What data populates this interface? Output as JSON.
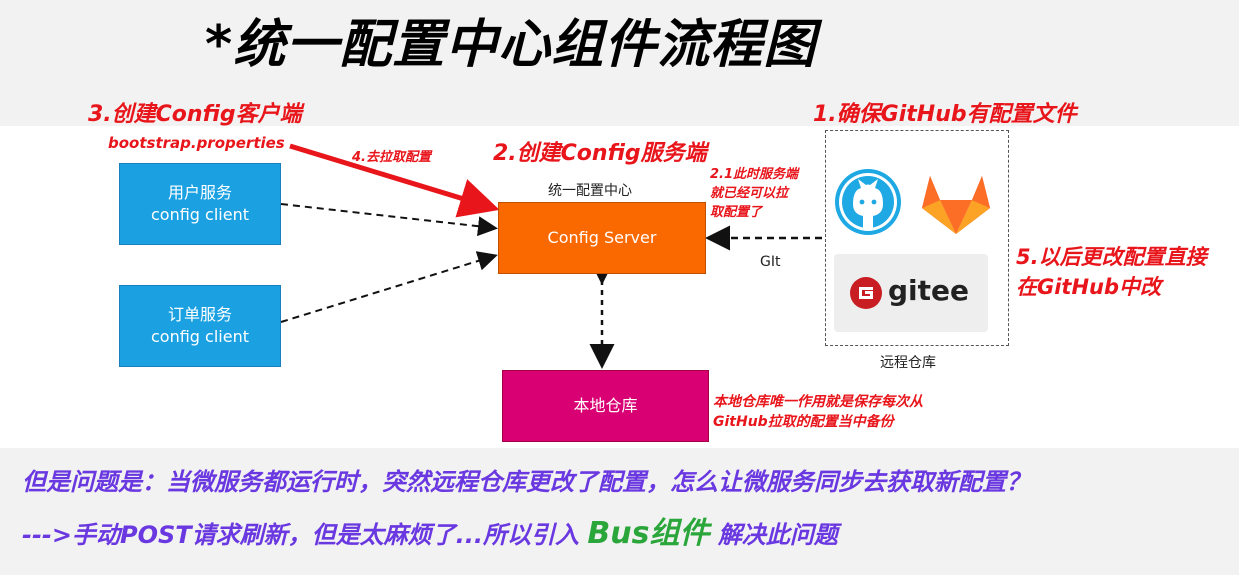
{
  "title": "*统一配置中心组件流程图",
  "steps": {
    "step1": "1.确保GitHub有配置文件",
    "step2": "2.创建Config服务端",
    "step2_1_line1": "2.1此时服务端",
    "step2_1_line2": "就已经可以拉",
    "step2_1_line3": "取配置了",
    "step3": "3.创建Config客户端",
    "step3_file": "bootstrap.properties",
    "step4": "4.去拉取配置",
    "step5_line1": "5.以后更改配置直接",
    "step5_line2": "在GitHub中改"
  },
  "nodes": {
    "user_service_line1": "用户服务",
    "user_service_line2": "config client",
    "order_service_line1": "订单服务",
    "order_service_line2": "config client",
    "server_caption": "统一配置中心",
    "server_label": "Config Server",
    "local_repo": "本地仓库",
    "remote_repo": "远程仓库",
    "git_label": "GIt",
    "gitee_text": "gitee"
  },
  "notes": {
    "local_note_line1": "本地仓库唯一作用就是保存每次从",
    "local_note_line2": "GitHub拉取的配置当中备份"
  },
  "bottom": {
    "question": "但是问题是：当微服务都运行时，突然远程仓库更改了配置，怎么让微服务同步去获取新配置？",
    "answer_prefix": "--->手动POST请求刷新，但是太麻烦了...所以引入",
    "answer_highlight": "Bus组件",
    "answer_suffix": "解决此问题"
  },
  "colors": {
    "client": "#1ba1e2",
    "server": "#fa6800",
    "local": "#d80073",
    "annotation_red": "#e8151b",
    "bottom_purple": "#6a38e0",
    "highlight_green": "#2aa63a"
  },
  "icons": [
    "github-octocat-icon",
    "gitlab-fox-icon",
    "gitee-logo-icon"
  ]
}
